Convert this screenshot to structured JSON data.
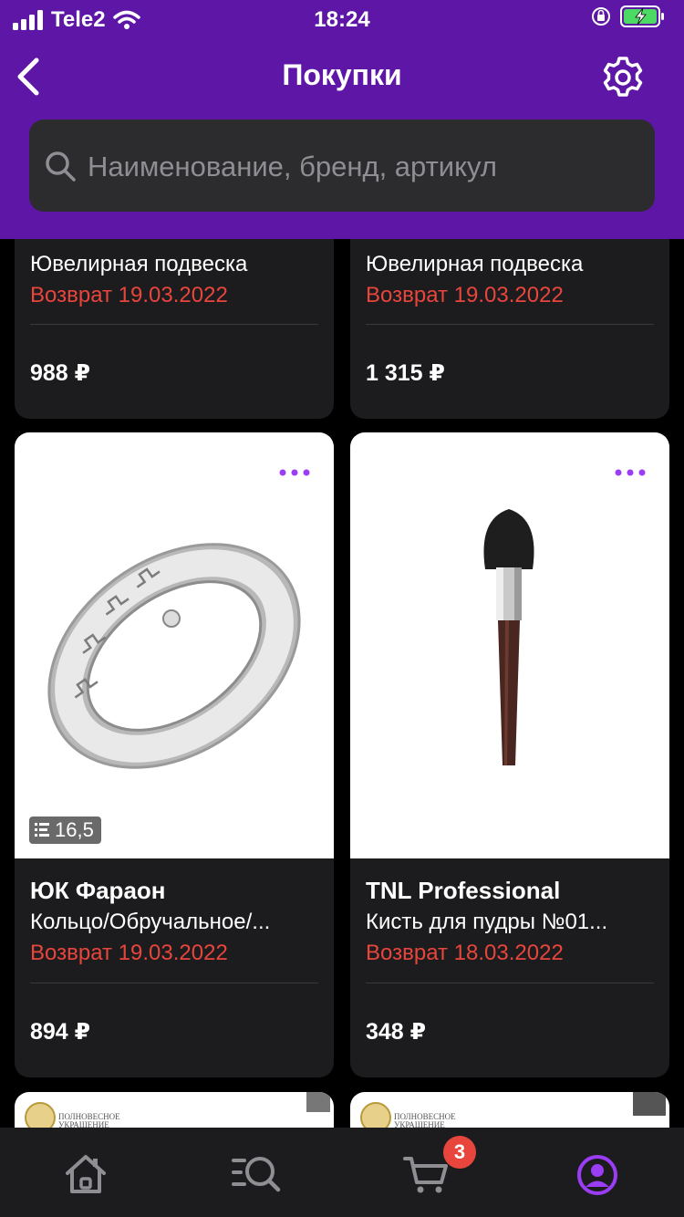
{
  "status_bar": {
    "carrier": "Tele2",
    "time": "18:24"
  },
  "nav": {
    "title": "Покупки"
  },
  "search": {
    "placeholder": "Наименование, бренд, артикул",
    "value": ""
  },
  "products": [
    {
      "name": "Ювелирная подвеска",
      "return_text": "Возврат 19.03.2022",
      "price": "988 ₽"
    },
    {
      "name": "Ювелирная подвеска",
      "return_text": "Возврат 19.03.2022",
      "price": "1 315 ₽"
    },
    {
      "brand": "ЮК Фараон",
      "name": "Кольцо/Обручальное/...",
      "return_text": "Возврат 19.03.2022",
      "price": "894 ₽",
      "size": "16,5",
      "icon": "ring-image"
    },
    {
      "brand": "TNL Professional",
      "name": "Кисть для пудры №01...",
      "return_text": "Возврат 18.03.2022",
      "price": "348 ₽",
      "icon": "powder-brush-image"
    },
    {
      "logo_text": "ПОЛНОВЕСНОЕ УКРАШЕНИЕ"
    },
    {
      "logo_text": "ПОЛНОВЕСНОЕ УКРАШЕНИЕ"
    }
  ],
  "tabbar": {
    "items": [
      "home-icon",
      "catalog-search-icon",
      "cart-icon",
      "profile-icon"
    ],
    "cart_badge": "3",
    "active": "profile-icon"
  },
  "colors": {
    "header": "#5e16a6",
    "accent": "#9b3df5",
    "return": "#e8453c",
    "card": "#1c1c1e"
  }
}
